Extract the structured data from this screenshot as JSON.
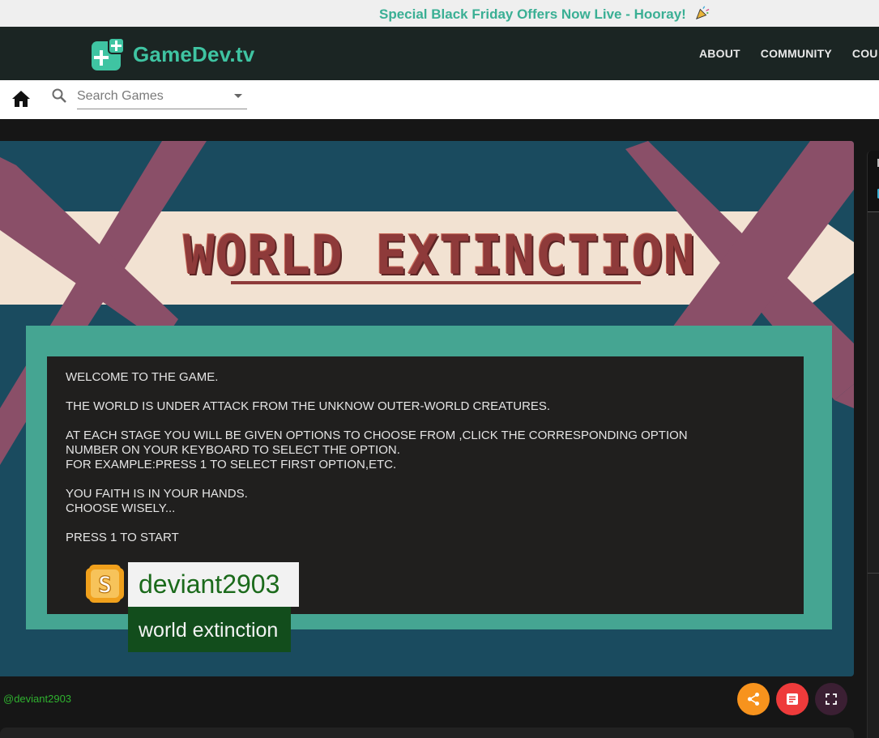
{
  "promo": {
    "text": "Special Black Friday Offers Now Live - Hooray!",
    "icon": "party-popper-icon"
  },
  "header": {
    "brand": "GameDev.tv",
    "logo_icon": "plus-logo-icon",
    "nav": [
      {
        "label": "ABOUT"
      },
      {
        "label": "COMMUNITY"
      },
      {
        "label": "COU"
      }
    ]
  },
  "search": {
    "placeholder": "Search Games",
    "value": "",
    "home_icon": "home-icon",
    "search_icon": "search-icon"
  },
  "game": {
    "title": "WORLD EXTINCTION",
    "console_lines": [
      "WELCOME TO THE GAME.",
      "",
      "THE WORLD IS UNDER ATTACK FROM THE UNKNOW OUTER-WORLD CREATURES.",
      "",
      "AT EACH STAGE YOU WILL BE GIVEN OPTIONS TO CHOOSE FROM ,CLICK THE CORRESPONDING OPTION",
      "NUMBER ON YOUR KEYBOARD TO SELECT THE OPTION.",
      "FOR EXAMPLE:PRESS 1 TO SELECT FIRST OPTION,ETC.",
      "",
      "YOU FAITH IS IN YOUR HANDS.",
      "CHOOSE WISELY...",
      "",
      "PRESS 1 TO START"
    ],
    "author_tag": "deviant2903",
    "game_tag": "world extinction"
  },
  "footer": {
    "author_link": "@deviant2903",
    "actions": [
      {
        "name": "share",
        "icon": "share-icon",
        "color": "#f7931d"
      },
      {
        "name": "notes",
        "icon": "notes-icon",
        "color": "#ee3b3b"
      },
      {
        "name": "fullscreen",
        "icon": "fullscreen-icon",
        "color": "#3b1f33"
      }
    ]
  },
  "colors": {
    "brand": "#3fc4a2",
    "nav_bg": "#1b2523",
    "game_bg": "#1a4b5f",
    "ribbon": "#f2e2d2",
    "cross": "#8a4f68",
    "teal_frame": "#45a592",
    "console_bg": "#201f1e",
    "title": "#8e3a3a"
  }
}
